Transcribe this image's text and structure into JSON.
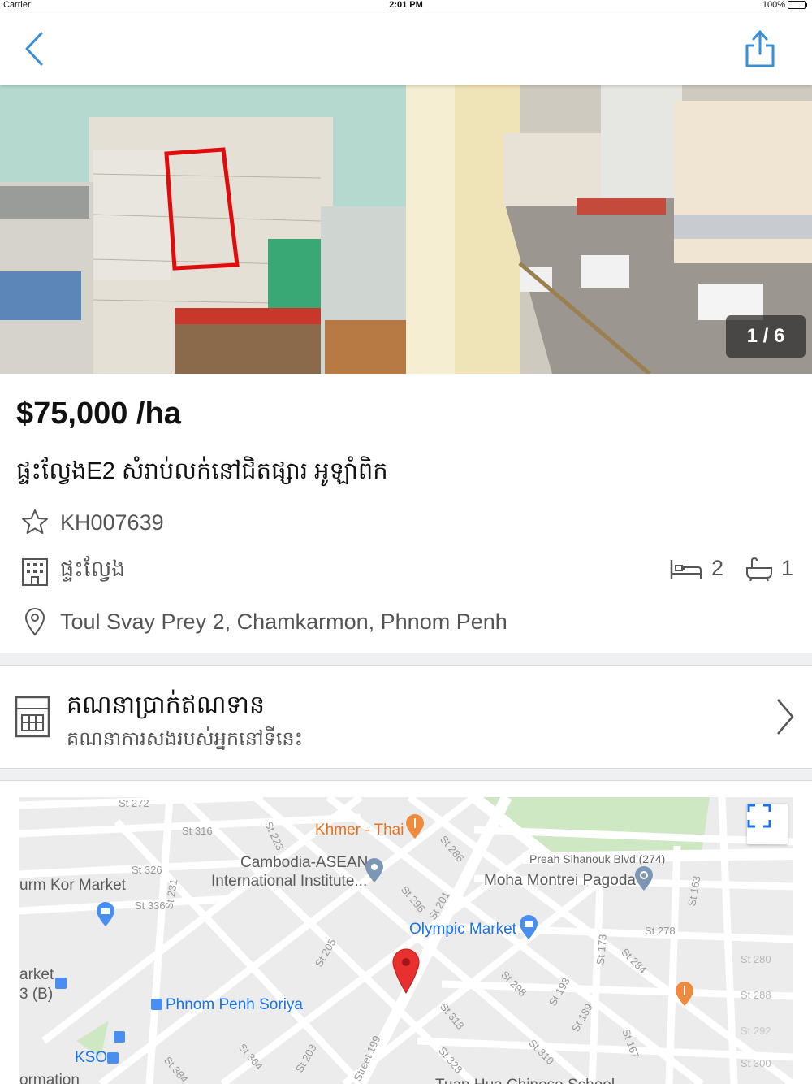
{
  "status_bar": {
    "carrier": "Carrier",
    "time": "2:01 PM",
    "battery": "100%"
  },
  "nav": {
    "back_icon": "chevron-left-icon",
    "share_icon": "share-icon",
    "accent": "#3a8fd4"
  },
  "gallery": {
    "counter": "1 / 6"
  },
  "listing": {
    "price": "$75,000 /ha",
    "title": "ផ្ទះល្វែងE2 សំរាប់លក់នៅជិតផ្សារ អូឡាំពិក",
    "code": "KH007639",
    "type": "ផ្ទះល្វែង",
    "bedrooms": "2",
    "bathrooms": "1",
    "address": "Toul Svay Prey 2, Chamkarmon, Phnom Penh"
  },
  "calculator": {
    "title": "គណនាប្រាក់ឥណទាន",
    "subtitle": "គណនាការសងរបស់អ្នកនៅទីនេះ"
  },
  "map": {
    "labels": {
      "st272": "St 272",
      "st316": "St 316",
      "st223": "St 223",
      "st326": "St 326",
      "st336": "St 336",
      "st231": "St 231",
      "st286": "St 286",
      "st296": "St 296",
      "st201": "St 201",
      "st205": "St 205",
      "st278": "St 278",
      "st163": "St 163",
      "st173": "St 173",
      "st284": "St 284",
      "st298": "St 298",
      "st193": "St 193",
      "st189": "St 189",
      "st280": "St 280",
      "st288": "St 288",
      "st292": "St 292",
      "st318": "St 318",
      "st310": "St 310",
      "st167": "St 167",
      "st300": "St 300",
      "st328": "St 328",
      "st364": "St 364",
      "st203": "St 203",
      "st199": "Street 199",
      "st384": "St 384"
    },
    "places": {
      "khmer_thai": "Khmer - Thai",
      "cambodia_asean_1": "Cambodia-ASEAN",
      "cambodia_asean_2": "International Institute...",
      "preah_sihanouk": "Preah Sihanouk Blvd (274)",
      "moha_montrei": "Moha Montrei Pagoda",
      "orussey_market": "urm Kor Market",
      "olympic_market": "Olympic Market",
      "market_b1": "arket",
      "market_b2": "3 (B)",
      "phnom_penh_soriya": "Phnom Penh Soriya",
      "kso": "KSO",
      "formation": "ormation",
      "tuan_hua": "Tuan Hua Chinese School"
    }
  }
}
